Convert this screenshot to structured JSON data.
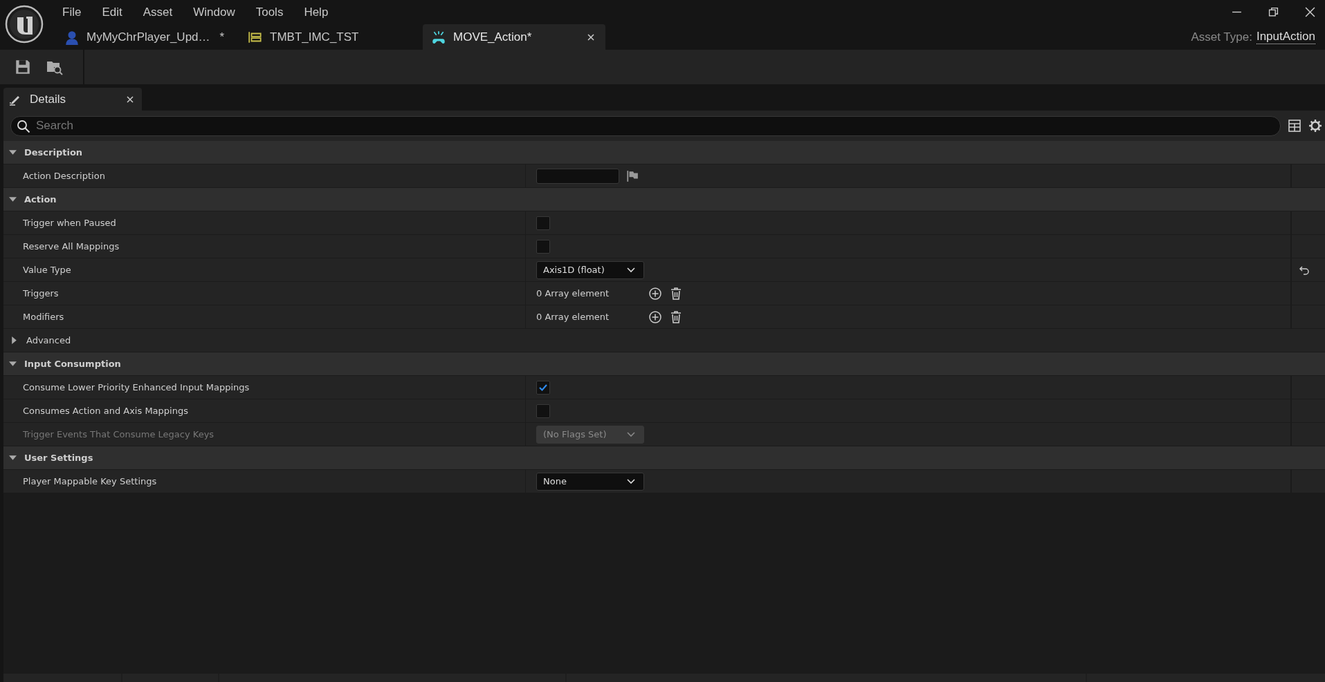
{
  "menu": [
    "File",
    "Edit",
    "Asset",
    "Window",
    "Tools",
    "Help"
  ],
  "tabs": [
    {
      "label": "MyMyChrPlayer_Upd…",
      "marker": "*",
      "kind": "character",
      "selected": false
    },
    {
      "label": "TMBT_IMC_TST",
      "kind": "mapping",
      "selected": false
    },
    {
      "label": "MOVE_Action",
      "marker": "*",
      "kind": "action",
      "selected": true
    }
  ],
  "asset_type": {
    "label": "Asset Type:",
    "value": "InputAction"
  },
  "panel": {
    "title": "Details"
  },
  "search": {
    "placeholder": "Search"
  },
  "sections": [
    {
      "title": "Description",
      "expanded": true,
      "rows": [
        {
          "label": "Action Description",
          "kind": "text"
        }
      ]
    },
    {
      "title": "Action",
      "expanded": true,
      "rows": [
        {
          "label": "Trigger when Paused",
          "kind": "checkbox",
          "checked": false
        },
        {
          "label": "Reserve All Mappings",
          "kind": "checkbox",
          "checked": false
        },
        {
          "label": "Value Type",
          "kind": "dropdown",
          "value": "Axis1D (float)",
          "disabled": false,
          "reset": true
        },
        {
          "label": "Triggers",
          "kind": "array",
          "value": "0 Array element"
        },
        {
          "label": "Modifiers",
          "kind": "array",
          "value": "0 Array element"
        },
        {
          "label": "Advanced",
          "kind": "group",
          "expanded": false
        }
      ]
    },
    {
      "title": "Input Consumption",
      "expanded": true,
      "rows": [
        {
          "label": "Consume Lower Priority Enhanced Input Mappings",
          "kind": "checkbox",
          "checked": true
        },
        {
          "label": "Consumes Action and Axis Mappings",
          "kind": "checkbox",
          "checked": false
        },
        {
          "label": "Trigger Events That Consume Legacy Keys",
          "kind": "dropdown",
          "value": "(No Flags Set)",
          "disabled": true
        }
      ]
    },
    {
      "title": "User Settings",
      "expanded": true,
      "rows": [
        {
          "label": "Player Mappable Key Settings",
          "kind": "dropdown",
          "value": "None",
          "disabled": false
        }
      ]
    }
  ]
}
